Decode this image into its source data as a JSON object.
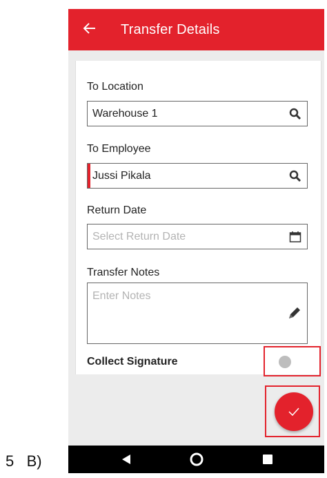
{
  "caption": {
    "number": "5",
    "letter": "B)"
  },
  "appbar": {
    "title": "Transfer Details",
    "back_icon": "arrow-left-icon"
  },
  "form": {
    "to_location": {
      "label": "To Location",
      "value": "Warehouse 1",
      "icon": "search-icon"
    },
    "to_employee": {
      "label": "To Employee",
      "value": "Jussi Pikala",
      "icon": "search-icon"
    },
    "return_date": {
      "label": "Return Date",
      "placeholder": "Select Return Date",
      "icon": "calendar-icon"
    },
    "transfer_notes": {
      "label": "Transfer Notes",
      "placeholder": "Enter Notes",
      "icon": "pencil-icon"
    },
    "collect_signature": {
      "label": "Collect Signature",
      "toggle_on": false
    }
  },
  "fab": {
    "icon": "check-icon"
  },
  "navbar": {
    "icons": [
      "back-triangle-icon",
      "home-circle-icon",
      "recents-square-icon"
    ]
  },
  "colors": {
    "brand": "#e3222c",
    "background": "#ececec"
  }
}
